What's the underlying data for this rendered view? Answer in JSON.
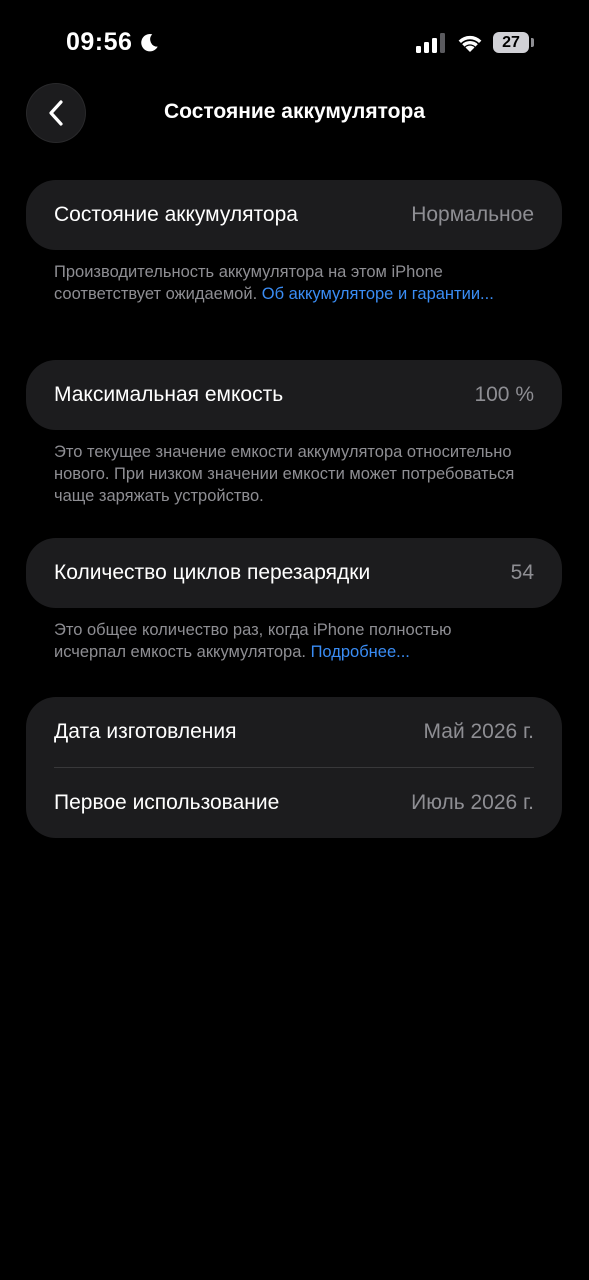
{
  "status_bar": {
    "time": "09:56",
    "battery_level": "27",
    "icons": [
      "moon-icon",
      "cellular-signal-icon",
      "wifi-icon",
      "battery-icon"
    ]
  },
  "nav": {
    "back_icon": "chevron-left-icon",
    "title": "Состояние аккумулятора"
  },
  "battery_health": {
    "label": "Состояние аккумулятора",
    "value": "Нормальное",
    "note_text": "Производительность аккумулятора на этом iPhone соответствует ожидаемой. ",
    "note_link": "Об аккумуляторе и гаран­тии..."
  },
  "max_capacity": {
    "label": "Максимальная емкость",
    "value": "100 %",
    "note_text": "Это текущее значение емкости аккумулятора относительно нового. При низком значении емкости может потребоваться чаще заряжать устройство."
  },
  "cycle_count": {
    "label": "Количество циклов перезарядки",
    "value": "54",
    "note_text": "Это общее количество раз, когда iPhone полностью исчерпал емкость аккумулятора. ",
    "note_link": "Подробнее..."
  },
  "dates": {
    "manufacture_label": "Дата изготовления",
    "manufacture_value": "Май 2026 г.",
    "first_use_label": "Первое использование",
    "first_use_value": "Июль 2026 г."
  },
  "colors": {
    "background": "#000000",
    "card": "#1c1c1e",
    "secondary_text": "#8e8e93",
    "link": "#3a8df5"
  }
}
